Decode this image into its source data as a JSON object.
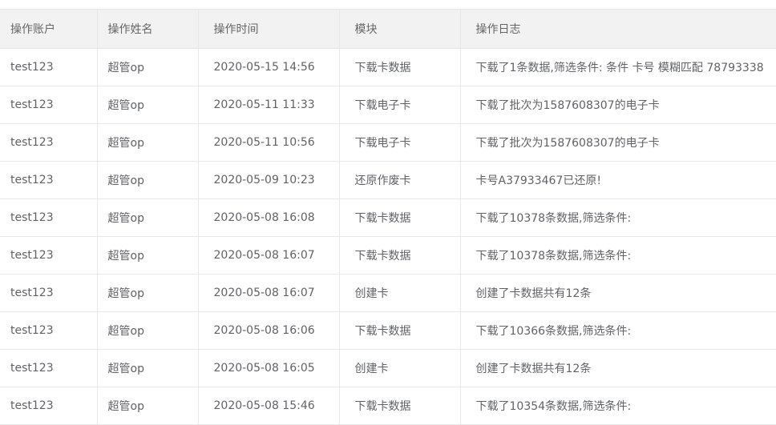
{
  "table": {
    "columns": [
      "操作账户",
      "操作姓名",
      "操作时间",
      "模块",
      "操作日志"
    ],
    "rows": [
      [
        "test123",
        "超管op",
        "2020-05-15 14:56",
        "下载卡数据",
        "下载了1条数据,筛选条件: 条件 卡号 模糊匹配 78793338"
      ],
      [
        "test123",
        "超管op",
        "2020-05-11 11:33",
        "下载电子卡",
        "下载了批次为1587608307的电子卡"
      ],
      [
        "test123",
        "超管op",
        "2020-05-11 10:56",
        "下载电子卡",
        "下载了批次为1587608307的电子卡"
      ],
      [
        "test123",
        "超管op",
        "2020-05-09 10:23",
        "还原作废卡",
        "卡号A37933467已还原!"
      ],
      [
        "test123",
        "超管op",
        "2020-05-08 16:08",
        "下载卡数据",
        "下载了10378条数据,筛选条件:"
      ],
      [
        "test123",
        "超管op",
        "2020-05-08 16:07",
        "下载卡数据",
        "下载了10378条数据,筛选条件:"
      ],
      [
        "test123",
        "超管op",
        "2020-05-08 16:07",
        "创建卡",
        "创建了卡数据共有12条"
      ],
      [
        "test123",
        "超管op",
        "2020-05-08 16:06",
        "下载卡数据",
        "下载了10366条数据,筛选条件:"
      ],
      [
        "test123",
        "超管op",
        "2020-05-08 16:05",
        "创建卡",
        "创建了卡数据共有12条"
      ],
      [
        "test123",
        "超管op",
        "2020-05-08 15:46",
        "下载卡数据",
        "下载了10354条数据,筛选条件:"
      ]
    ]
  }
}
